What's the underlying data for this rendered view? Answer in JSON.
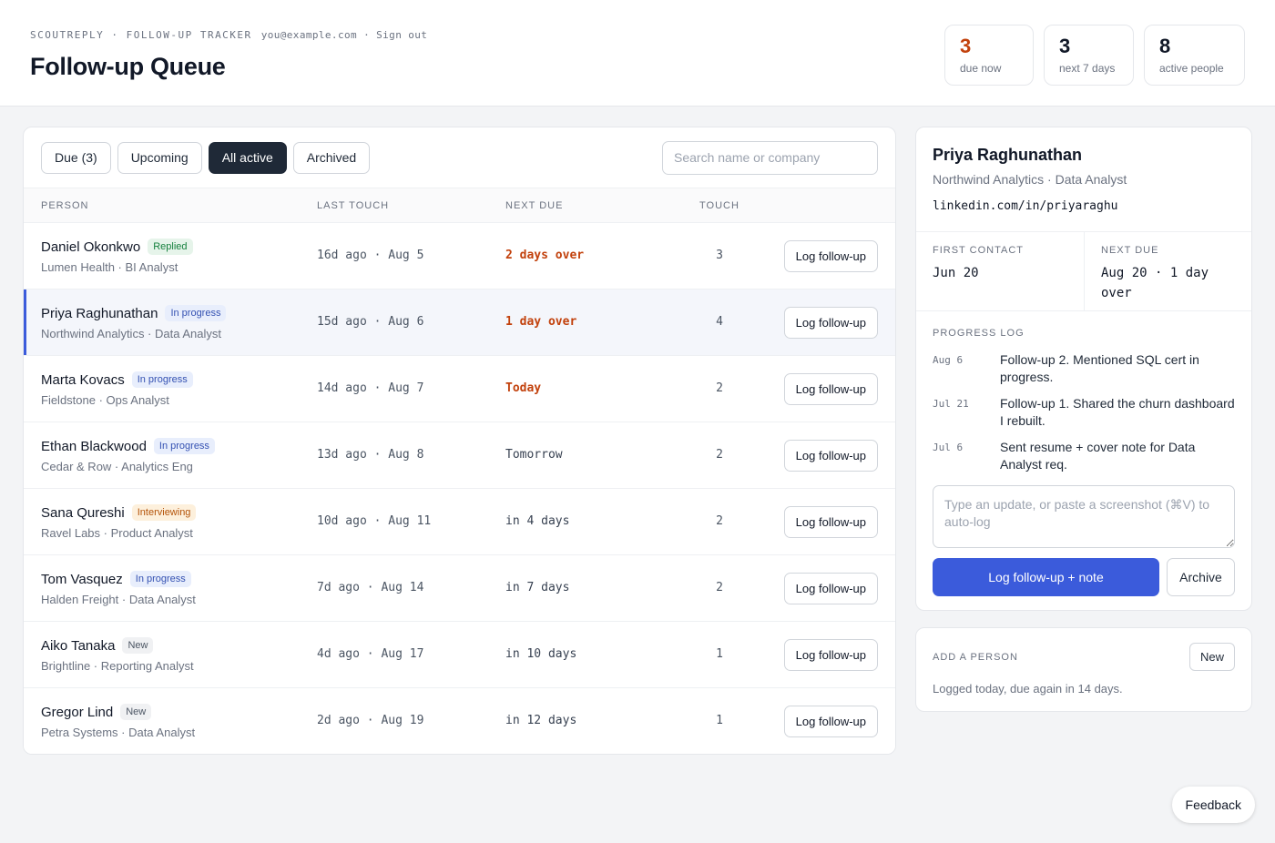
{
  "header": {
    "brand": "SCOUTREPLY · FOLLOW-UP TRACKER",
    "user_email": "you@example.com",
    "separator": "·",
    "sign_out": "Sign out",
    "title": "Follow-up Queue"
  },
  "stats": [
    {
      "value": "3",
      "label": "due now"
    },
    {
      "value": "3",
      "label": "next 7 days"
    },
    {
      "value": "8",
      "label": "active people"
    }
  ],
  "filters": [
    {
      "label": "Due (3)",
      "active": false
    },
    {
      "label": "Upcoming",
      "active": false
    },
    {
      "label": "All active",
      "active": true
    },
    {
      "label": "Archived",
      "active": false
    }
  ],
  "search": {
    "placeholder": "Search name or company",
    "value": ""
  },
  "table": {
    "headers": {
      "person": "PERSON",
      "last": "LAST TOUCH",
      "next": "NEXT DUE",
      "touch": "TOUCH"
    },
    "rows": [
      {
        "name": "Daniel Okonkwo",
        "badge": "Replied",
        "badge_type": "replied",
        "org": "Lumen Health · BI Analyst",
        "last": "16d ago · Aug 5",
        "next": "2 days over",
        "over": true,
        "touch": "3",
        "action": "Log follow-up"
      },
      {
        "name": "Priya Raghunathan",
        "badge": "In progress",
        "badge_type": "progress",
        "org": "Northwind Analytics · Data Analyst",
        "last": "15d ago · Aug 6",
        "next": "1 day over",
        "over": true,
        "touch": "4",
        "action": "Log follow-up",
        "selected": true
      },
      {
        "name": "Marta Kovacs",
        "badge": "In progress",
        "badge_type": "progress",
        "org": "Fieldstone · Ops Analyst",
        "last": "14d ago · Aug 7",
        "next": "Today",
        "over": true,
        "touch": "2",
        "action": "Log follow-up"
      },
      {
        "name": "Ethan Blackwood",
        "badge": "In progress",
        "badge_type": "progress",
        "org": "Cedar & Row · Analytics Eng",
        "last": "13d ago · Aug 8",
        "next": "Tomorrow",
        "over": false,
        "touch": "2",
        "action": "Log follow-up"
      },
      {
        "name": "Sana Qureshi",
        "badge": "Interviewing",
        "badge_type": "interview",
        "org": "Ravel Labs · Product Analyst",
        "last": "10d ago · Aug 11",
        "next": "in 4 days",
        "over": false,
        "touch": "2",
        "action": "Log follow-up"
      },
      {
        "name": "Tom Vasquez",
        "badge": "In progress",
        "badge_type": "progress",
        "org": "Halden Freight · Data Analyst",
        "last": "7d ago · Aug 14",
        "next": "in 7 days",
        "over": false,
        "touch": "2",
        "action": "Log follow-up"
      },
      {
        "name": "Aiko Tanaka",
        "badge": "New",
        "badge_type": "new",
        "org": "Brightline · Reporting Analyst",
        "last": "4d ago · Aug 17",
        "next": "in 10 days",
        "over": false,
        "touch": "1",
        "action": "Log follow-up"
      },
      {
        "name": "Gregor Lind",
        "badge": "New",
        "badge_type": "new",
        "org": "Petra Systems · Data Analyst",
        "last": "2d ago · Aug 19",
        "next": "in 12 days",
        "over": false,
        "touch": "1",
        "action": "Log follow-up"
      }
    ]
  },
  "detail": {
    "name": "Priya Raghunathan",
    "subtitle": "Northwind Analytics · Data Analyst",
    "link": "linkedin.com/in/priyaraghu",
    "first_contact_label": "FIRST CONTACT",
    "first_contact": "Jun 20",
    "next_due_label": "NEXT DUE",
    "next_due": "Aug 20 · 1 day over",
    "log_label": "PROGRESS LOG",
    "log": [
      {
        "date": "Aug 6",
        "text": "Follow-up 2. Mentioned SQL cert in progress."
      },
      {
        "date": "Jul 21",
        "text": "Follow-up 1. Shared the churn dashboard I rebuilt."
      },
      {
        "date": "Jul 6",
        "text": "Sent resume + cover note for Data Analyst req."
      }
    ],
    "note_placeholder": "Type an update, or paste a screenshot (⌘V) to auto-log",
    "primary_action": "Log follow-up + note",
    "archive_action": "Archive"
  },
  "add_person": {
    "label": "ADD A PERSON",
    "button": "New",
    "message": "Logged today, due again in 14 days."
  },
  "feedback": "Feedback",
  "colors": {
    "accent": "#3b5bdb",
    "overdue": "#c2410c",
    "dark": "#1f2937"
  }
}
